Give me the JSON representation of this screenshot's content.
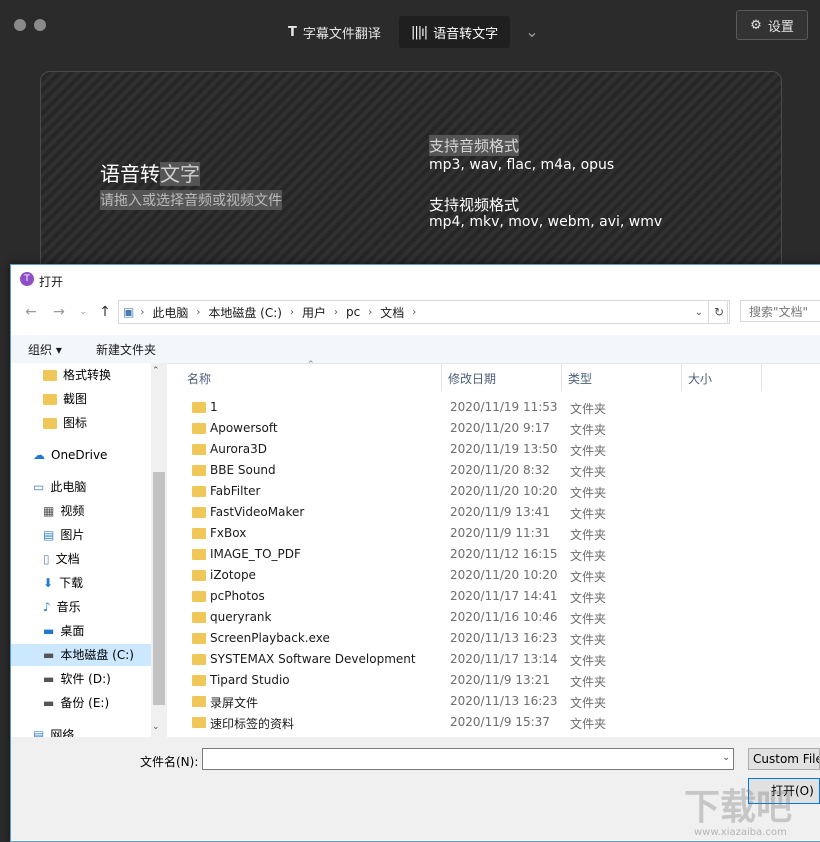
{
  "app": {
    "tab_subtitle": "字幕文件翻译",
    "tab_speech": "语音转文字",
    "settings_label": "设置",
    "drop_title_a": "语音转",
    "drop_title_b": "文字",
    "drop_subtitle": "请拖入或选择音频或视频文件",
    "audio_heading": "支持音频格式",
    "audio_formats": "mp3, wav, flac, m4a, opus",
    "video_heading": "支持视频格式",
    "video_formats": "mp4, mkv, mov, webm, avi, wmv"
  },
  "dialog": {
    "title": "打开",
    "breadcrumb": [
      "此电脑",
      "本地磁盘 (C:)",
      "用户",
      "pc",
      "文档"
    ],
    "search_placeholder": "搜索\"文档\"",
    "organize": "组织",
    "new_folder": "新建文件夹",
    "nav": [
      {
        "label": "格式转换",
        "icon": "folder-icon"
      },
      {
        "label": "截图",
        "icon": "folder-icon"
      },
      {
        "label": "图标",
        "icon": "folder-icon"
      },
      {
        "label": "OneDrive",
        "icon": "cloud-icon"
      },
      {
        "label": "此电脑",
        "icon": "computer-icon"
      },
      {
        "label": "视频",
        "icon": "video-icon"
      },
      {
        "label": "图片",
        "icon": "image-icon"
      },
      {
        "label": "文档",
        "icon": "document-icon"
      },
      {
        "label": "下载",
        "icon": "download-icon"
      },
      {
        "label": "音乐",
        "icon": "music-icon"
      },
      {
        "label": "桌面",
        "icon": "desktop-icon"
      },
      {
        "label": "本地磁盘 (C:)",
        "icon": "drive-icon"
      },
      {
        "label": "软件 (D:)",
        "icon": "drive-icon"
      },
      {
        "label": "备份 (E:)",
        "icon": "drive-icon"
      },
      {
        "label": "网络",
        "icon": "network-icon"
      }
    ],
    "columns": {
      "name": "名称",
      "date": "修改日期",
      "type": "类型",
      "size": "大小"
    },
    "files": [
      {
        "name": "1",
        "date": "2020/11/19 11:53",
        "type": "文件夹"
      },
      {
        "name": "Apowersoft",
        "date": "2020/11/20 9:17",
        "type": "文件夹"
      },
      {
        "name": "Aurora3D",
        "date": "2020/11/19 13:50",
        "type": "文件夹"
      },
      {
        "name": "BBE Sound",
        "date": "2020/11/20 8:32",
        "type": "文件夹"
      },
      {
        "name": "FabFilter",
        "date": "2020/11/20 10:20",
        "type": "文件夹"
      },
      {
        "name": "FastVideoMaker",
        "date": "2020/11/9 13:41",
        "type": "文件夹"
      },
      {
        "name": "FxBox",
        "date": "2020/11/9 11:31",
        "type": "文件夹"
      },
      {
        "name": "IMAGE_TO_PDF",
        "date": "2020/11/12 16:15",
        "type": "文件夹"
      },
      {
        "name": "iZotope",
        "date": "2020/11/20 10:20",
        "type": "文件夹"
      },
      {
        "name": "pcPhotos",
        "date": "2020/11/17 14:41",
        "type": "文件夹"
      },
      {
        "name": "queryrank",
        "date": "2020/11/16 10:46",
        "type": "文件夹"
      },
      {
        "name": "ScreenPlayback.exe",
        "date": "2020/11/13 16:23",
        "type": "文件夹"
      },
      {
        "name": "SYSTEMAX Software Development",
        "date": "2020/11/17 13:14",
        "type": "文件夹"
      },
      {
        "name": "Tipard Studio",
        "date": "2020/11/9 13:21",
        "type": "文件夹"
      },
      {
        "name": "录屏文件",
        "date": "2020/11/13 16:23",
        "type": "文件夹"
      },
      {
        "name": "速印标签的资料",
        "date": "2020/11/9 15:37",
        "type": "文件夹"
      }
    ],
    "filename_label": "文件名(N):",
    "filename_value": "",
    "filetype": "Custom Files",
    "open_button": "打开(O)"
  },
  "watermark": {
    "main": "下载吧",
    "sub": "www.xiazaiba.com"
  }
}
